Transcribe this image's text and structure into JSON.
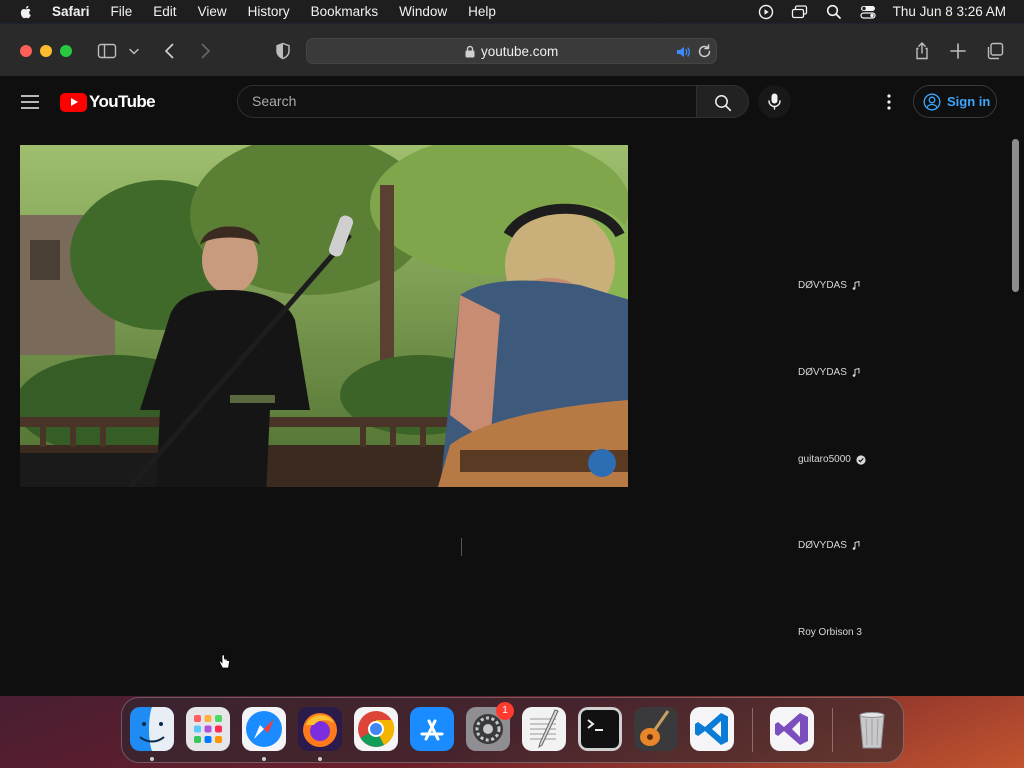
{
  "menubar": {
    "app_name": "Safari",
    "items": [
      "File",
      "Edit",
      "View",
      "History",
      "Bookmarks",
      "Window",
      "Help"
    ],
    "clock": "Thu Jun 8  3:26 AM"
  },
  "browser": {
    "url": "youtube.com"
  },
  "youtube": {
    "logo_text": "YouTube",
    "search_placeholder": "Search",
    "signin_label": "Sign in"
  },
  "sidebar": {
    "items": [
      {
        "channel": "DØVYDAS",
        "badge": "music-note-icon"
      },
      {
        "channel": "DØVYDAS",
        "badge": "music-note-icon"
      },
      {
        "channel": "guitaro5000",
        "badge": "verified-check-icon"
      },
      {
        "channel": "DØVYDAS",
        "badge": "music-note-icon"
      },
      {
        "channel": "Roy Orbison 3",
        "badge": ""
      }
    ]
  },
  "dock": {
    "apps": [
      "Finder",
      "Launchpad",
      "Safari",
      "Firefox",
      "Chrome",
      "App Store",
      "System Settings",
      "TextEdit",
      "Terminal",
      "GarageBand",
      "Visual Studio Code",
      "Visual Studio",
      "Trash"
    ],
    "settings_badge": "1"
  },
  "colors": {
    "yt_red": "#ff0000",
    "signin_blue": "#3ea6ff",
    "page_bg": "#0f0f0f"
  }
}
